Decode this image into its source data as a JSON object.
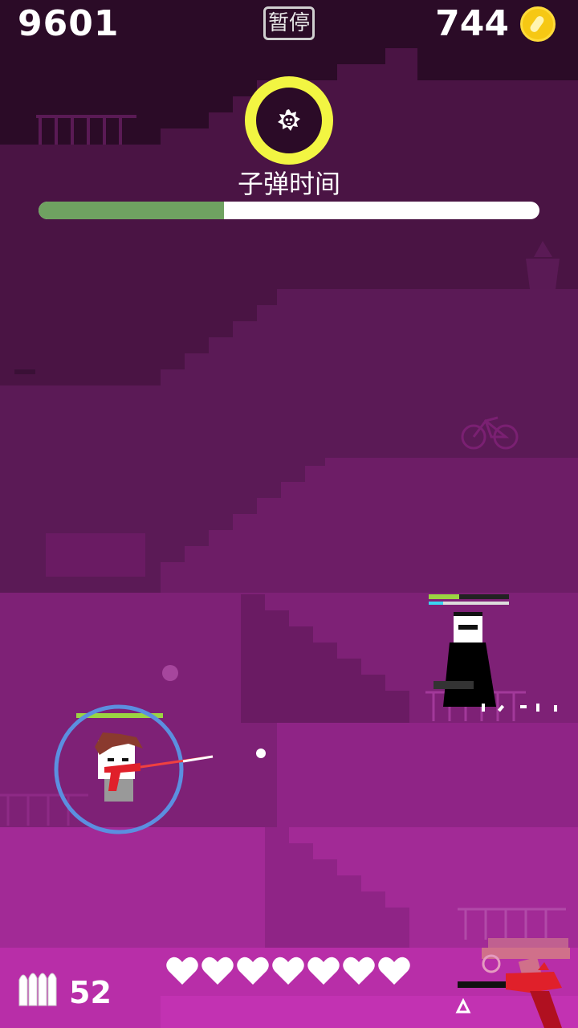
{
  "hud": {
    "score": "9601",
    "pause_label": "暂停",
    "coins": "744"
  },
  "bullet_time": {
    "label": "子弹时间",
    "progress": 0.37
  },
  "ammo": {
    "count": "52"
  },
  "health": {
    "hearts": 7
  },
  "colors": {
    "bullet_time_ring": "#f2f542",
    "progress_fill": "#6fa261",
    "coin": "#f6c814",
    "player_shield": "#5b8fe0"
  },
  "icons": {
    "bullet_time": "skull-star-icon",
    "coin": "coin-icon",
    "ammo": "bullets-icon",
    "swap": "weapon-swap-icon"
  }
}
